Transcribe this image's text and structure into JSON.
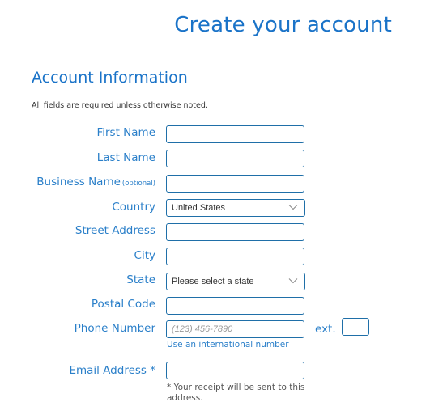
{
  "header": {
    "title": "Create your account"
  },
  "section": {
    "title": "Account Information",
    "note": "All fields are required unless otherwise noted."
  },
  "form": {
    "first_name": {
      "label": "First Name",
      "value": ""
    },
    "last_name": {
      "label": "Last Name",
      "value": ""
    },
    "business_name": {
      "label": "Business Name",
      "optional_tag": "(optional)",
      "value": ""
    },
    "country": {
      "label": "Country",
      "selected": "United States",
      "icon": "chevron-down-icon"
    },
    "street_address": {
      "label": "Street Address",
      "value": ""
    },
    "city": {
      "label": "City",
      "value": ""
    },
    "state": {
      "label": "State",
      "selected": "Please select a state",
      "icon": "chevron-down-icon"
    },
    "postal_code": {
      "label": "Postal Code",
      "value": ""
    },
    "phone_number": {
      "label": "Phone Number",
      "placeholder": "(123) 456-7890",
      "value": "",
      "ext_label": "ext.",
      "ext_value": "",
      "international_link": "Use an international number"
    },
    "email_address": {
      "label": "Email Address *",
      "value": "",
      "helper": "* Your receipt will be sent to this address."
    }
  },
  "colors": {
    "accent": "#1a73c8",
    "label": "#2a7fc9",
    "field_border": "#1f6fa8"
  }
}
